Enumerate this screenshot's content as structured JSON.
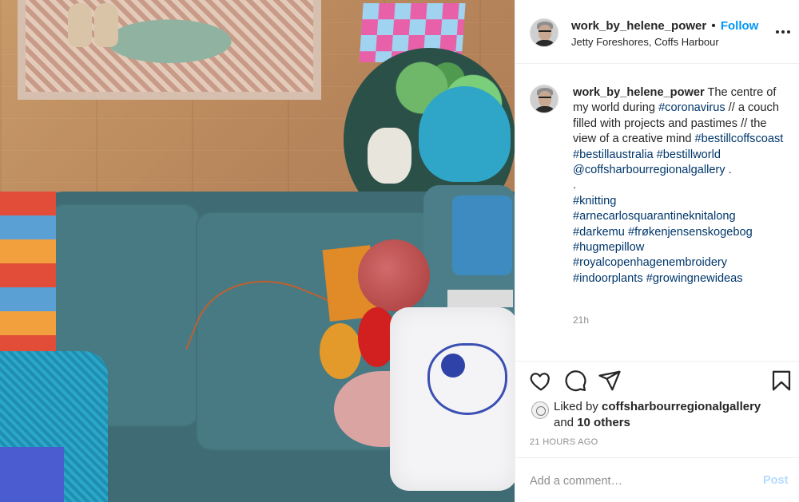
{
  "post": {
    "username": "work_by_helene_power",
    "separator": "•",
    "follow_label": "Follow",
    "location": "Jetty Foreshores, Coffs Harbour",
    "more_icon": "more-horizontal-icon"
  },
  "caption": {
    "username": "work_by_helene_power",
    "text_1": " The centre of my world during ",
    "tag_coronavirus": "#coronavirus",
    "text_2": " // a couch filled with projects and pastimes // the view of a creative mind ",
    "tag_bestillcoffscoast": "#bestillcoffscoast",
    "tag_bestillaustralia": "#bestillaustralia",
    "tag_bestillworld": "#bestillworld",
    "mention_gallery": "@coffsharbourregionalgallery",
    "text_3": " .",
    "dot_line": ".",
    "tag_knitting": "#knitting",
    "tag_arnecarlos": "#arnecarlosquarantineknitalong",
    "tag_darkemu": "#darkemu",
    "tag_frokenjensen": "#frøkenjensenskogebog",
    "tag_hugmepillow": "#hugmepillow",
    "tag_royalcopenhagen": "#royalcopenhagenembroidery",
    "tag_indoorplants": "#indoorplants",
    "tag_growingnewideas": "#growingnewideas",
    "age": "21h"
  },
  "actions": {
    "like_icon": "heart-icon",
    "comment_icon": "comment-icon",
    "share_icon": "share-icon",
    "save_icon": "bookmark-icon"
  },
  "likes": {
    "prefix": "Liked by ",
    "user": "coffsharbourregionalgallery",
    "and": "and ",
    "others": "10 others"
  },
  "post_age": "21 HOURS AGO",
  "comment": {
    "placeholder": "Add a comment…",
    "post_label": "Post"
  },
  "colors": {
    "link_blue": "#0095f6",
    "hashtag_blue": "#00376b",
    "post_disabled": "#b3dbff",
    "muted_text": "#8e8e8e"
  }
}
